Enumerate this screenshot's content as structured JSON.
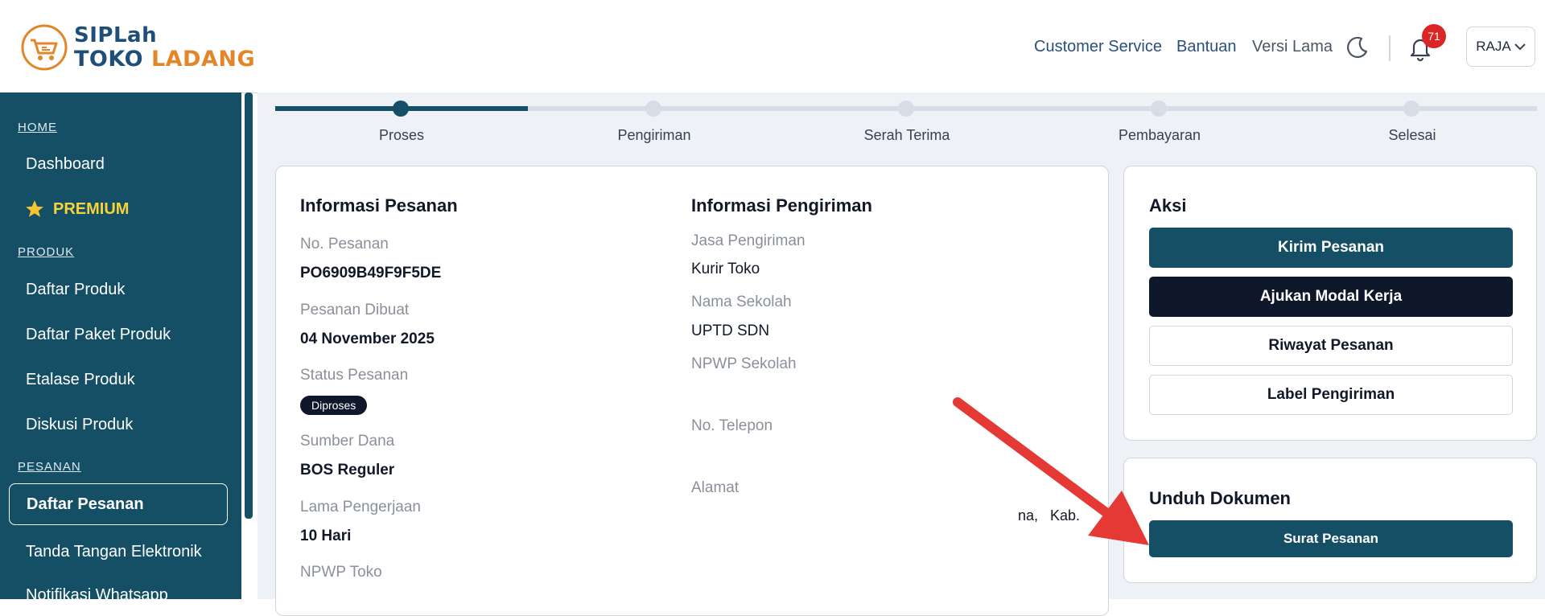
{
  "app": {
    "logo_line1": "SIPLah",
    "logo_line2a": "TOKO",
    "logo_line2b": "LADANG"
  },
  "header": {
    "customer_service": "Customer Service",
    "help": "Bantuan",
    "old_version": "Versi Lama",
    "notification_count": "71",
    "user": "RAJA"
  },
  "sidebar": {
    "home_section": "HOME",
    "dashboard": "Dashboard",
    "premium": "PREMIUM",
    "product_section": "PRODUK",
    "product_list": "Daftar Produk",
    "product_package_list": "Daftar Paket Produk",
    "product_showcase": "Etalase Produk",
    "product_discussion": "Diskusi Produk",
    "order_section": "PESANAN",
    "order_list": "Daftar Pesanan",
    "e_signature": "Tanda Tangan Elektronik",
    "whatsapp_notification": "Notifikasi Whatsapp"
  },
  "steps": [
    "Proses",
    "Pengiriman",
    "Serah Terima",
    "Pembayaran",
    "Selesai"
  ],
  "active_step": 1,
  "order_info": {
    "title": "Informasi Pesanan",
    "order_no_label": "No. Pesanan",
    "order_no": "PO6909B49F9F5DE",
    "created_label": "Pesanan Dibuat",
    "created": "04 November 2025",
    "status_label": "Status Pesanan",
    "status": "Diproses",
    "fund_label": "Sumber Dana",
    "fund": "BOS Reguler",
    "duration_label": "Lama Pengerjaan",
    "duration": "10 Hari",
    "npwp_store_label": "NPWP Toko"
  },
  "shipping_info": {
    "title": "Informasi Pengiriman",
    "courier_label": "Jasa Pengiriman",
    "courier": "Kurir Toko",
    "school_label": "Nama Sekolah",
    "school": "UPTD SDN",
    "npwp_school_label": "NPWP Sekolah",
    "phone_label": "No. Telepon",
    "address_label": "Alamat",
    "address_fragment": "na,   Kab."
  },
  "actions": {
    "title": "Aksi",
    "send_order": "Kirim Pesanan",
    "working_capital": "Ajukan Modal Kerja",
    "order_history": "Riwayat Pesanan",
    "shipping_label": "Label Pengiriman"
  },
  "download": {
    "title": "Unduh Dokumen",
    "purchase_order": "Surat Pesanan"
  },
  "colors": {
    "primary": "#154f66",
    "dark": "#0f172a",
    "annotation": "#e53935",
    "badge": "#dc2626"
  }
}
